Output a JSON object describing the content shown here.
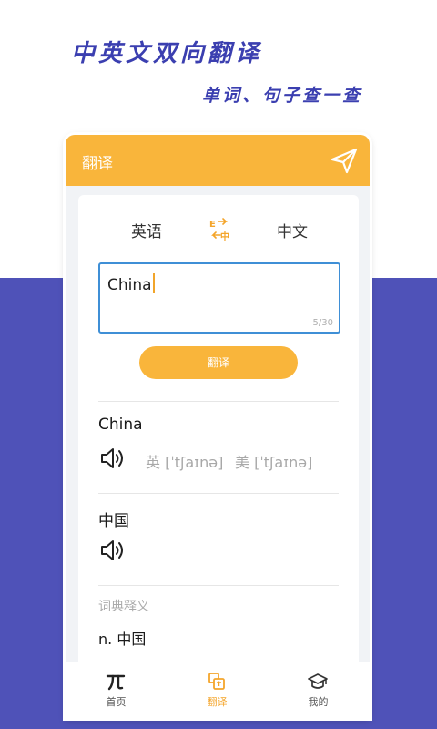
{
  "promo": {
    "headline": "中英文双向翻译",
    "subline": "单词、句子查一查"
  },
  "colors": {
    "accent": "#f9b53b",
    "background_band": "#4f52b8",
    "headline": "#3b3fb0",
    "input_border": "#3f8fd6"
  },
  "app": {
    "title": "翻译",
    "send_icon": "send-icon"
  },
  "language": {
    "source": "英语",
    "target": "中文",
    "swap_icon": "swap-language-icon"
  },
  "input": {
    "value": "China",
    "counter": "5/30"
  },
  "translate_button": "翻译",
  "result": {
    "source_word": "China",
    "uk_phonetic": "英 [ˈtʃaɪnə]",
    "us_phonetic": "美 [ˈtʃaɪnə]",
    "translated_word": "中国"
  },
  "dictionary": {
    "title": "词典释义",
    "definition": "n. 中国"
  },
  "tabs": [
    {
      "label": "首页",
      "icon": "pi-icon",
      "active": false
    },
    {
      "label": "翻译",
      "icon": "translate-icon",
      "active": true
    },
    {
      "label": "我的",
      "icon": "graduation-cap-icon",
      "active": false
    }
  ]
}
